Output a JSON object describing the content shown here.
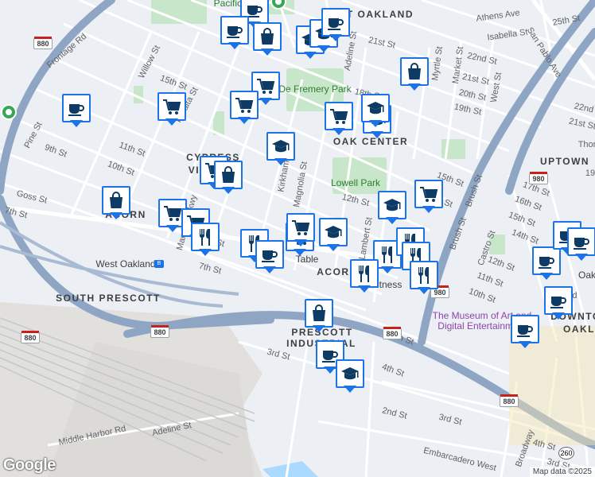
{
  "streets": [
    {
      "text": "WEST OAKLAND"
    },
    {
      "text": "Athens Ave"
    },
    {
      "text": "25th St"
    },
    {
      "text": "Isabella St"
    },
    {
      "text": "San Pablo Ave"
    },
    {
      "text": "22nd St"
    },
    {
      "text": "21st St"
    },
    {
      "text": "20th St"
    },
    {
      "text": "19th St"
    },
    {
      "text": "Frontage Rd"
    },
    {
      "text": "Willow St"
    },
    {
      "text": "Adeline St"
    },
    {
      "text": "21st St"
    },
    {
      "text": "Myrtle St"
    },
    {
      "text": "Market St"
    },
    {
      "text": "West St"
    },
    {
      "text": "15th St"
    },
    {
      "text": "Peralta St"
    },
    {
      "text": "18th St"
    },
    {
      "text": "Pine St"
    },
    {
      "text": "9th St"
    },
    {
      "text": "11th St"
    },
    {
      "text": "10th St"
    },
    {
      "text": "Goss St"
    },
    {
      "text": "7th St"
    },
    {
      "text": "8th St"
    },
    {
      "text": "7th St"
    },
    {
      "text": "Mandela Pkwy"
    },
    {
      "text": "Magnolia St"
    },
    {
      "text": "Kirkham St"
    },
    {
      "text": "12th St"
    },
    {
      "text": "14th St"
    },
    {
      "text": "15th St"
    },
    {
      "text": "Brush St"
    },
    {
      "text": "Brush St"
    },
    {
      "text": "Castro St"
    },
    {
      "text": "17th St"
    },
    {
      "text": "16th St"
    },
    {
      "text": "15th St"
    },
    {
      "text": "14th St"
    },
    {
      "text": "12th St"
    },
    {
      "text": "11th St"
    },
    {
      "text": "10th St"
    },
    {
      "text": "6th St"
    },
    {
      "text": "4th St"
    },
    {
      "text": "3rd St"
    },
    {
      "text": "2nd St"
    },
    {
      "text": "3rd St"
    },
    {
      "text": "Adeline St"
    },
    {
      "text": "Middle Harbor Rd"
    },
    {
      "text": "Embarcadero West"
    },
    {
      "text": "Broadway"
    },
    {
      "text": "4th St"
    },
    {
      "text": "3rd St"
    },
    {
      "text": "Lambert St"
    },
    {
      "text": "Oakland"
    },
    {
      "text": "22nd"
    },
    {
      "text": "21st St"
    },
    {
      "text": "Thor"
    },
    {
      "text": "19"
    }
  ],
  "neighborhoods": [
    {
      "text": "CYPRESS"
    },
    {
      "text": "VILLAGE"
    },
    {
      "text": "ACORN"
    },
    {
      "text": "OAK CENTER"
    },
    {
      "text": "SOUTH PRESCOTT"
    },
    {
      "text": "ACORN"
    },
    {
      "text": "INDUSTRIAL"
    },
    {
      "text": "UPTOWN"
    },
    {
      "text": "DOWNTO"
    },
    {
      "text": "OAKL"
    },
    {
      "text": "PRESCOTT"
    }
  ],
  "parks": [
    {
      "text": "De Fremery Park"
    },
    {
      "text": "Lowell Park"
    },
    {
      "text": "Pacific Pipe"
    }
  ],
  "pois": [
    {
      "text": "West Oakland"
    },
    {
      "text": "Oak"
    },
    {
      "text": "Fitness"
    },
    {
      "text": "Table"
    }
  ],
  "museum_label": "The Museum of Art and Digital Entertainment",
  "highway_shields": [
    "880",
    "880",
    "880",
    "880",
    "980",
    "980",
    "880"
  ],
  "route_260": "260",
  "map_markers": [
    {
      "icon": "cafe"
    },
    {
      "icon": "cafe"
    },
    {
      "icon": "shopping"
    },
    {
      "icon": "education"
    },
    {
      "icon": "education"
    },
    {
      "icon": "cafe"
    },
    {
      "icon": "shopping"
    },
    {
      "icon": "grocery"
    },
    {
      "icon": "cafe"
    },
    {
      "icon": "grocery"
    },
    {
      "icon": "grocery"
    },
    {
      "icon": "grocery"
    },
    {
      "icon": "education"
    },
    {
      "icon": "education"
    },
    {
      "icon": "education"
    },
    {
      "icon": "grocery"
    },
    {
      "icon": "shopping"
    },
    {
      "icon": "shopping"
    },
    {
      "icon": "grocery"
    },
    {
      "icon": "grocery"
    },
    {
      "icon": "restaurant"
    },
    {
      "icon": "restaurant"
    },
    {
      "icon": "cafe"
    },
    {
      "icon": "grocery"
    },
    {
      "icon": "grocery"
    },
    {
      "icon": "education"
    },
    {
      "icon": "education"
    },
    {
      "icon": "grocery"
    },
    {
      "icon": "restaurant"
    },
    {
      "icon": "restaurant"
    },
    {
      "icon": "restaurant"
    },
    {
      "icon": "restaurant"
    },
    {
      "icon": "restaurant"
    },
    {
      "icon": "cafe"
    },
    {
      "icon": "cafe"
    },
    {
      "icon": "cafe"
    },
    {
      "icon": "cafe"
    },
    {
      "icon": "cafe"
    },
    {
      "icon": "shopping"
    },
    {
      "icon": "cafe"
    },
    {
      "icon": "education"
    }
  ],
  "google_logo": "Google",
  "attribution": "Map data ©2025",
  "colors": {
    "marker_border": "#1a73e8",
    "marker_icon": "#0d3b66",
    "park": "#c8e6c9",
    "highway": "#8fa5c4"
  }
}
